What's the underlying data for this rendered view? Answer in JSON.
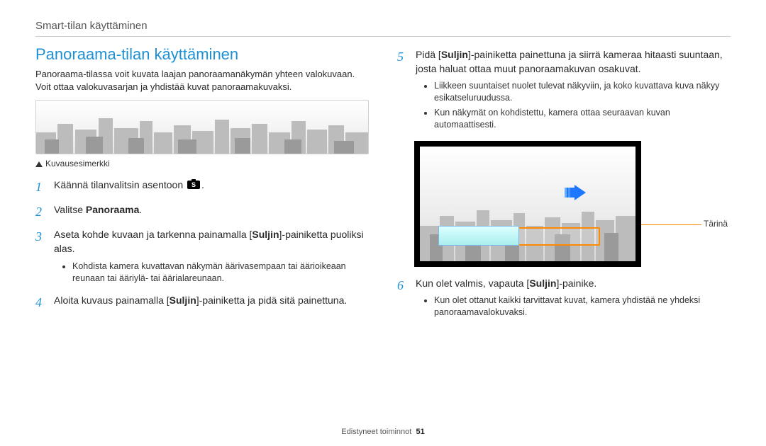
{
  "header": "Smart-tilan käyttäminen",
  "left": {
    "title": "Panoraama-tilan käyttäminen",
    "intro": "Panoraama-tilassa voit kuvata laajan panoraamanäkymän yhteen valokuvaan. Voit ottaa valokuvasarjan ja yhdistää kuvat panoraamakuvaksi.",
    "caption": "Kuvausesimerkki",
    "steps": [
      {
        "num": "1",
        "pre": "Käännä tilanvalitsin asentoon ",
        "post": "."
      },
      {
        "num": "2",
        "pre": "Valitse ",
        "bold": "Panoraama",
        "post": "."
      },
      {
        "num": "3",
        "pre": "Aseta kohde kuvaan ja tarkenna painamalla [",
        "bold": "Suljin",
        "post": "]-painiketta puoliksi alas.",
        "bullets": [
          "Kohdista kamera kuvattavan näkymän äärivasempaan tai äärioikeaan reunaan tai ääriylä- tai äärialareunaan."
        ]
      },
      {
        "num": "4",
        "pre": "Aloita kuvaus painamalla [",
        "bold": "Suljin",
        "post": "]-painiketta ja pidä sitä painettuna."
      }
    ]
  },
  "right": {
    "step5": {
      "num": "5",
      "pre": "Pidä [",
      "bold": "Suljin",
      "post": "]-painiketta painettuna ja siirrä kameraa hitaasti suuntaan, josta haluat ottaa muut panoraamakuvan osakuvat.",
      "bullets": [
        "Liikkeen suuntaiset nuolet tulevat näkyviin, ja koko kuvattava kuva näkyy esikatseluruudussa.",
        "Kun näkymät on kohdistettu, kamera ottaa seuraavan kuvan automaattisesti."
      ]
    },
    "vibration_label": "Tärinä",
    "step6": {
      "num": "6",
      "pre": "Kun olet valmis, vapauta [",
      "bold": "Suljin",
      "post": "]-painike.",
      "bullets": [
        "Kun olet ottanut kaikki tarvittavat kuvat, kamera yhdistää ne yhdeksi panoraamavalokuvaksi."
      ]
    }
  },
  "footer": {
    "section": "Edistyneet toiminnot",
    "page": "51"
  }
}
